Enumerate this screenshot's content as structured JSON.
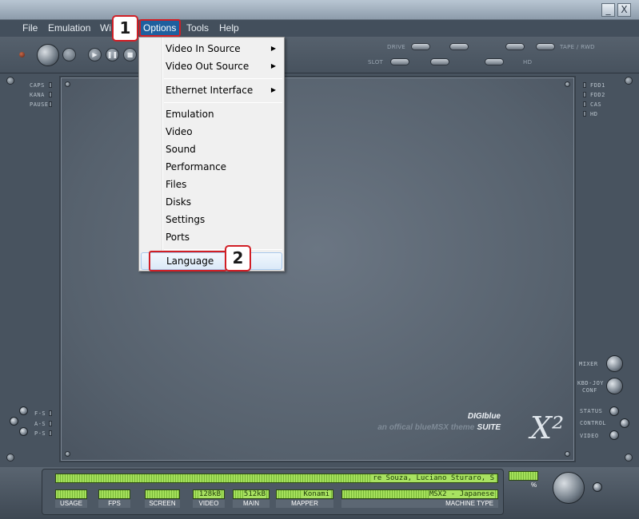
{
  "window": {
    "min_glyph": "_",
    "close_glyph": "X"
  },
  "menubar": {
    "items": [
      "File",
      "Emulation",
      "Wi",
      "Options",
      "Tools",
      "Help"
    ]
  },
  "toolbar": {
    "labels": {
      "drive": "DRIVE",
      "slot": "SLOT",
      "tape": "TAPE / RWD",
      "hd": "HD"
    },
    "transport": [
      "▶",
      "❚❚",
      "■"
    ]
  },
  "options_menu": {
    "items": [
      {
        "label": "Video In Source",
        "submenu": true
      },
      {
        "label": "Video Out Source",
        "submenu": true
      },
      {
        "label": "Ethernet Interface",
        "submenu": true
      },
      {
        "label": "Emulation",
        "submenu": false
      },
      {
        "label": "Video",
        "submenu": false
      },
      {
        "label": "Sound",
        "submenu": false
      },
      {
        "label": "Performance",
        "submenu": false
      },
      {
        "label": "Files",
        "submenu": false
      },
      {
        "label": "Disks",
        "submenu": false
      },
      {
        "label": "Settings",
        "submenu": false
      },
      {
        "label": "Ports",
        "submenu": false
      },
      {
        "label": "Language",
        "submenu": false
      }
    ],
    "submenu_glyph": "▶",
    "highlighted": "Language"
  },
  "callouts": [
    "1",
    "2"
  ],
  "left_panel": {
    "top_leds": [
      "CAPS",
      "KANA",
      "PAUSE"
    ],
    "bottom_leds": [
      "F-S",
      "A-S",
      "P-S"
    ]
  },
  "right_panel": {
    "top_leds": [
      "FDD1",
      "FDD2",
      "CAS",
      "HD"
    ],
    "mixer": "MIXER",
    "kbd_joy": "KBD-JOY",
    "conf": "CONF",
    "status": "STATUS",
    "control": "CONTROL",
    "video": "VIDEO"
  },
  "brand": {
    "name": "DIGIblue",
    "suite": "SUITE",
    "tagline": "an offical blueMSX theme",
    "logo": "X²"
  },
  "status_bar": {
    "ticker": "re Souza, Luciano Sturaro, S",
    "usage": {
      "label": "USAGE",
      "value": ""
    },
    "fps": {
      "label": "FPS",
      "value": ""
    },
    "screen": {
      "label": "SCREEN",
      "value": ""
    },
    "video": {
      "label": "VIDEO",
      "value": "128kB"
    },
    "main": {
      "label": "MAIN",
      "value": "512kB"
    },
    "mapper": {
      "label": "MAPPER",
      "value": "Konami"
    },
    "machine": {
      "label": "MACHINE TYPE",
      "value": "MSX2 - Japanese"
    },
    "percent_label": "%"
  },
  "colors": {
    "menu_active": "#1e5f9e",
    "callout_red": "#d11f26",
    "lcd_green": "#8fd14a"
  }
}
